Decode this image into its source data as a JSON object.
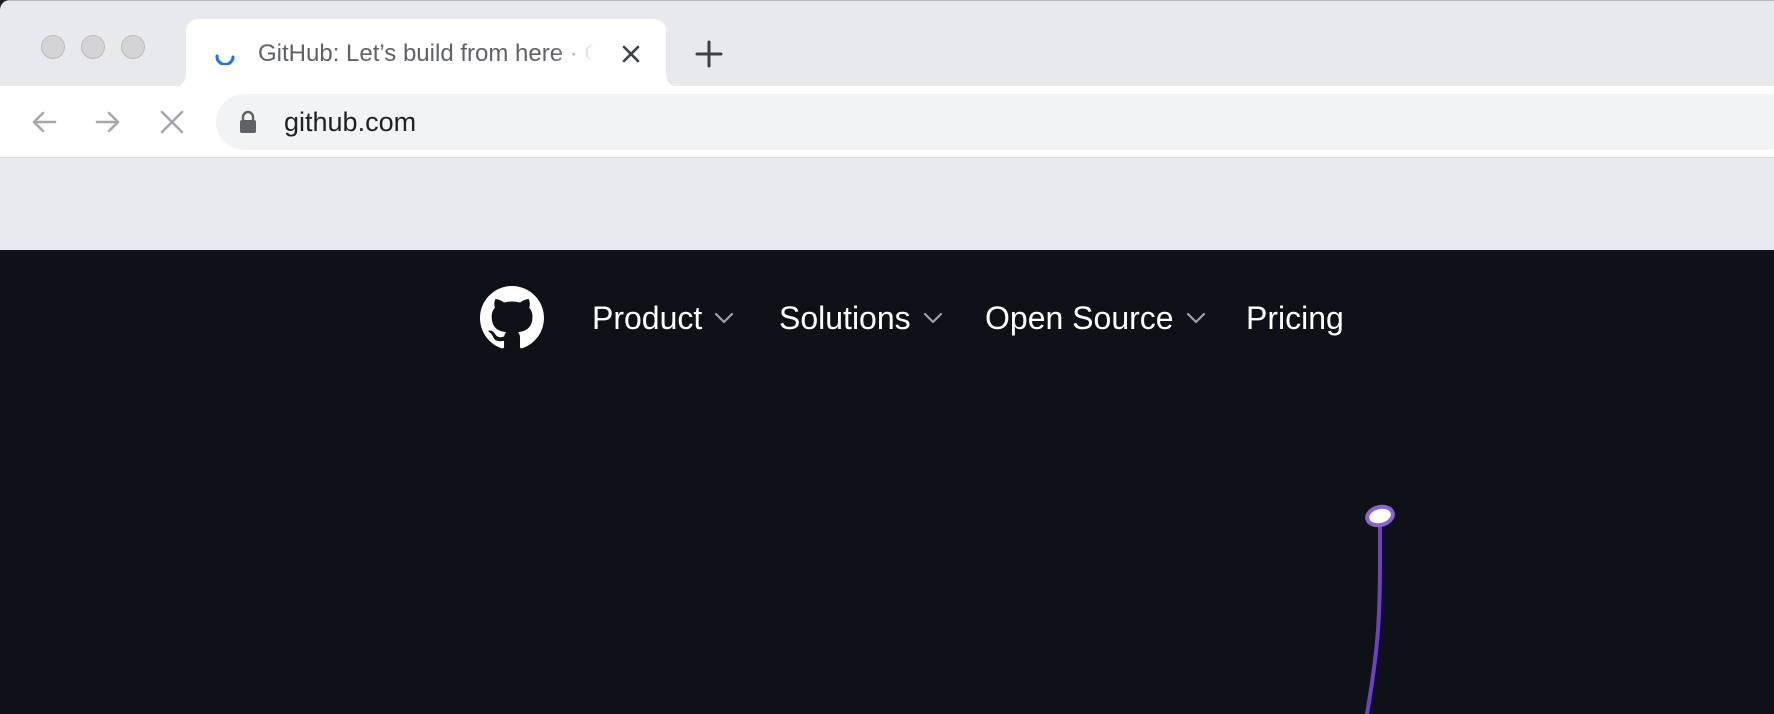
{
  "browser": {
    "tab": {
      "title": "GitHub: Let’s build from here · GitHub",
      "loading": true
    },
    "icons": {
      "traffic_lights": [
        "close-traffic-light",
        "minimize-traffic-light",
        "zoom-traffic-light"
      ],
      "new_tab": "plus-icon",
      "back": "arrow-left-icon",
      "forward": "arrow-right-icon",
      "stop": "close-icon",
      "secure": "lock-icon"
    },
    "address_bar": {
      "url": "github.com"
    }
  },
  "page": {
    "logo": "github-octocat-icon",
    "nav": {
      "items": [
        {
          "label": "Product",
          "has_dropdown": true
        },
        {
          "label": "Solutions",
          "has_dropdown": true
        },
        {
          "label": "Open Source",
          "has_dropdown": true
        },
        {
          "label": "Pricing",
          "has_dropdown": false
        }
      ]
    }
  },
  "colors": {
    "tabstrip": "#e8e9ed",
    "page_background": "#0e1117",
    "nav_text": "#ffffff",
    "accent_purple": "#6e40c9",
    "spinner_blue": "#1a73e8"
  }
}
